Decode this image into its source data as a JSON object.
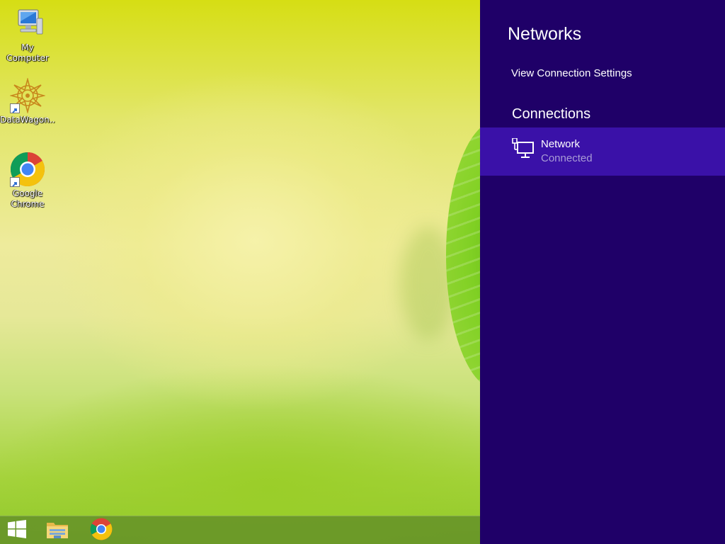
{
  "desktop": {
    "icons": [
      {
        "label": "My Computer",
        "icon": "computer-icon"
      },
      {
        "label": "DataWagon...",
        "icon": "datawagon-icon"
      },
      {
        "label": "Google Chrome",
        "icon": "chrome-icon"
      }
    ]
  },
  "taskbar": {
    "items": [
      {
        "icon": "windows-start-icon"
      },
      {
        "icon": "file-explorer-icon"
      },
      {
        "icon": "chrome-icon"
      }
    ]
  },
  "networks_panel": {
    "title": "Networks",
    "view_settings_link": "View Connection Settings",
    "connections_heading": "Connections",
    "connections": [
      {
        "name": "Network",
        "status": "Connected",
        "icon": "wired-network-icon"
      }
    ],
    "colors": {
      "background": "#1f0068",
      "selected_item": "#3a11a8",
      "status_text": "#a99cd6"
    }
  }
}
